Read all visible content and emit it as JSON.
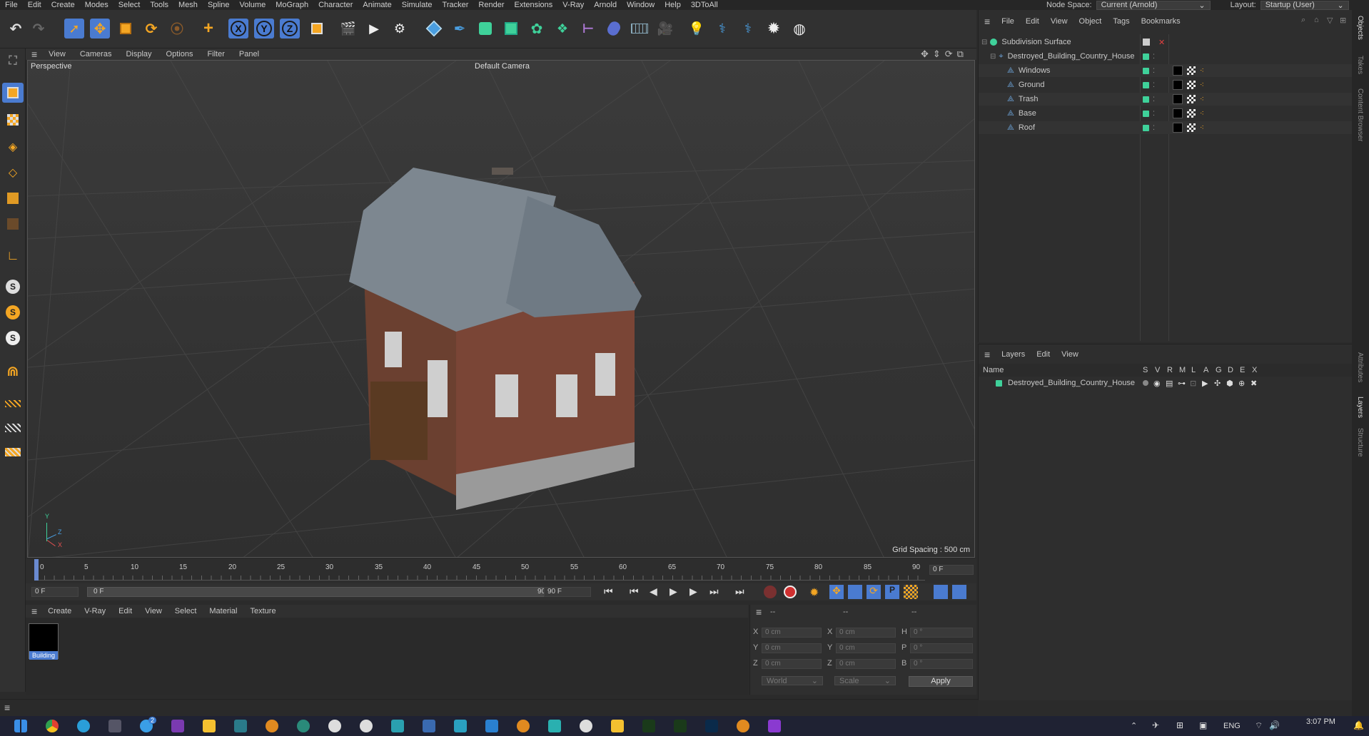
{
  "menubar": {
    "items": [
      "File",
      "Edit",
      "Create",
      "Modes",
      "Select",
      "Tools",
      "Mesh",
      "Spline",
      "Volume",
      "MoGraph",
      "Character",
      "Animate",
      "Simulate",
      "Tracker",
      "Render",
      "Extensions",
      "V-Ray",
      "Arnold",
      "Window",
      "Help",
      "3DToAll"
    ],
    "node_space_label": "Node Space:",
    "node_space_value": "Current (Arnold)",
    "layout_label": "Layout:",
    "layout_value": "Startup (User)"
  },
  "toolbar": {
    "axis_x": "X",
    "axis_y": "Y",
    "axis_z": "Z"
  },
  "left_toolbar": {
    "s1": "S",
    "s2": "S",
    "s3": "S"
  },
  "viewport": {
    "menu": [
      "View",
      "Cameras",
      "Display",
      "Options",
      "Filter",
      "Panel"
    ],
    "mode": "Perspective",
    "camera": "Default Camera",
    "grid_spacing": "Grid Spacing : 500 cm",
    "axis_y": "Y",
    "axis_z": "Z",
    "axis_x": "X"
  },
  "timeline": {
    "ticks": [
      "0",
      "5",
      "10",
      "15",
      "20",
      "25",
      "30",
      "35",
      "40",
      "45",
      "50",
      "55",
      "60",
      "65",
      "70",
      "75",
      "80",
      "85",
      "90"
    ],
    "current_frame": "0 F",
    "start_frame": "0 F",
    "range_start": "0 F",
    "range_end": "90 F",
    "end_frame": "90 F"
  },
  "material_panel": {
    "menu": [
      "Create",
      "V-Ray",
      "Edit",
      "View",
      "Select",
      "Material",
      "Texture"
    ],
    "material_name": "Building"
  },
  "coordinates": {
    "header_a": "--",
    "header_b": "--",
    "header_c": "--",
    "pos_x_label": "X",
    "pos_x": "0 cm",
    "pos_y_label": "Y",
    "pos_y": "0 cm",
    "pos_z_label": "Z",
    "pos_z": "0 cm",
    "size_x_label": "X",
    "size_x": "0 cm",
    "size_y_label": "Y",
    "size_y": "0 cm",
    "size_z_label": "Z",
    "size_z": "0 cm",
    "rot_h_label": "H",
    "rot_h": "0 °",
    "rot_p_label": "P",
    "rot_p": "0 °",
    "rot_b_label": "B",
    "rot_b": "0 °",
    "mode_value": "World",
    "scale_value": "Scale",
    "apply_label": "Apply"
  },
  "object_manager": {
    "menu": [
      "File",
      "Edit",
      "View",
      "Object",
      "Tags",
      "Bookmarks"
    ],
    "objects": [
      {
        "name": "Subdivision Surface",
        "depth": 0
      },
      {
        "name": "Destroyed_Building_Country_House",
        "depth": 1
      },
      {
        "name": "Windows",
        "depth": 2
      },
      {
        "name": "Ground",
        "depth": 2
      },
      {
        "name": "Trash",
        "depth": 2
      },
      {
        "name": "Base",
        "depth": 2
      },
      {
        "name": "Roof",
        "depth": 2
      }
    ]
  },
  "layer_manager": {
    "menu": [
      "Layers",
      "Edit",
      "View"
    ],
    "name_header": "Name",
    "columns": [
      "S",
      "V",
      "R",
      "M",
      "L",
      "A",
      "G",
      "D",
      "E",
      "X"
    ],
    "layers": [
      "Destroyed_Building_Country_House"
    ],
    "layer_color": "#3fd19a"
  },
  "right_tabs": [
    "Objects",
    "Takes",
    "Content Browser",
    "Attributes",
    "Layers",
    "Structure"
  ],
  "taskbar": {
    "language": "ENG",
    "time": "3:07 PM",
    "badge": "2"
  },
  "colors": {
    "accent_orange": "#f4a623",
    "selection_blue": "#4a7bd0",
    "layer_green": "#3fd19a"
  }
}
